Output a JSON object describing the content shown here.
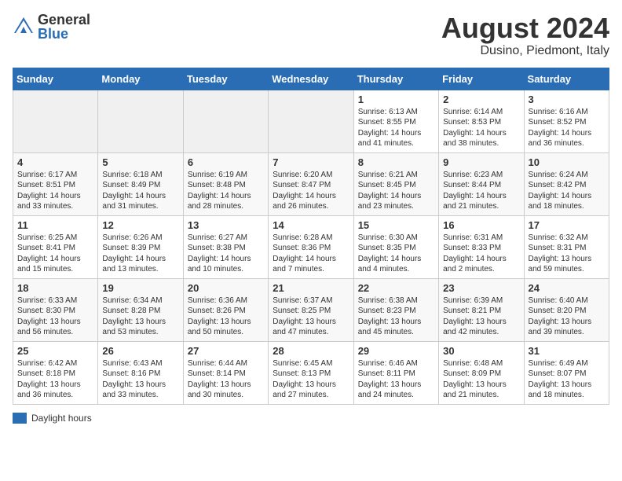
{
  "header": {
    "logo_general": "General",
    "logo_blue": "Blue",
    "month_title": "August 2024",
    "location": "Dusino, Piedmont, Italy"
  },
  "days_of_week": [
    "Sunday",
    "Monday",
    "Tuesday",
    "Wednesday",
    "Thursday",
    "Friday",
    "Saturday"
  ],
  "weeks": [
    [
      {
        "day": "",
        "info": ""
      },
      {
        "day": "",
        "info": ""
      },
      {
        "day": "",
        "info": ""
      },
      {
        "day": "",
        "info": ""
      },
      {
        "day": "1",
        "info": "Sunrise: 6:13 AM\nSunset: 8:55 PM\nDaylight: 14 hours and 41 minutes."
      },
      {
        "day": "2",
        "info": "Sunrise: 6:14 AM\nSunset: 8:53 PM\nDaylight: 14 hours and 38 minutes."
      },
      {
        "day": "3",
        "info": "Sunrise: 6:16 AM\nSunset: 8:52 PM\nDaylight: 14 hours and 36 minutes."
      }
    ],
    [
      {
        "day": "4",
        "info": "Sunrise: 6:17 AM\nSunset: 8:51 PM\nDaylight: 14 hours and 33 minutes."
      },
      {
        "day": "5",
        "info": "Sunrise: 6:18 AM\nSunset: 8:49 PM\nDaylight: 14 hours and 31 minutes."
      },
      {
        "day": "6",
        "info": "Sunrise: 6:19 AM\nSunset: 8:48 PM\nDaylight: 14 hours and 28 minutes."
      },
      {
        "day": "7",
        "info": "Sunrise: 6:20 AM\nSunset: 8:47 PM\nDaylight: 14 hours and 26 minutes."
      },
      {
        "day": "8",
        "info": "Sunrise: 6:21 AM\nSunset: 8:45 PM\nDaylight: 14 hours and 23 minutes."
      },
      {
        "day": "9",
        "info": "Sunrise: 6:23 AM\nSunset: 8:44 PM\nDaylight: 14 hours and 21 minutes."
      },
      {
        "day": "10",
        "info": "Sunrise: 6:24 AM\nSunset: 8:42 PM\nDaylight: 14 hours and 18 minutes."
      }
    ],
    [
      {
        "day": "11",
        "info": "Sunrise: 6:25 AM\nSunset: 8:41 PM\nDaylight: 14 hours and 15 minutes."
      },
      {
        "day": "12",
        "info": "Sunrise: 6:26 AM\nSunset: 8:39 PM\nDaylight: 14 hours and 13 minutes."
      },
      {
        "day": "13",
        "info": "Sunrise: 6:27 AM\nSunset: 8:38 PM\nDaylight: 14 hours and 10 minutes."
      },
      {
        "day": "14",
        "info": "Sunrise: 6:28 AM\nSunset: 8:36 PM\nDaylight: 14 hours and 7 minutes."
      },
      {
        "day": "15",
        "info": "Sunrise: 6:30 AM\nSunset: 8:35 PM\nDaylight: 14 hours and 4 minutes."
      },
      {
        "day": "16",
        "info": "Sunrise: 6:31 AM\nSunset: 8:33 PM\nDaylight: 14 hours and 2 minutes."
      },
      {
        "day": "17",
        "info": "Sunrise: 6:32 AM\nSunset: 8:31 PM\nDaylight: 13 hours and 59 minutes."
      }
    ],
    [
      {
        "day": "18",
        "info": "Sunrise: 6:33 AM\nSunset: 8:30 PM\nDaylight: 13 hours and 56 minutes."
      },
      {
        "day": "19",
        "info": "Sunrise: 6:34 AM\nSunset: 8:28 PM\nDaylight: 13 hours and 53 minutes."
      },
      {
        "day": "20",
        "info": "Sunrise: 6:36 AM\nSunset: 8:26 PM\nDaylight: 13 hours and 50 minutes."
      },
      {
        "day": "21",
        "info": "Sunrise: 6:37 AM\nSunset: 8:25 PM\nDaylight: 13 hours and 47 minutes."
      },
      {
        "day": "22",
        "info": "Sunrise: 6:38 AM\nSunset: 8:23 PM\nDaylight: 13 hours and 45 minutes."
      },
      {
        "day": "23",
        "info": "Sunrise: 6:39 AM\nSunset: 8:21 PM\nDaylight: 13 hours and 42 minutes."
      },
      {
        "day": "24",
        "info": "Sunrise: 6:40 AM\nSunset: 8:20 PM\nDaylight: 13 hours and 39 minutes."
      }
    ],
    [
      {
        "day": "25",
        "info": "Sunrise: 6:42 AM\nSunset: 8:18 PM\nDaylight: 13 hours and 36 minutes."
      },
      {
        "day": "26",
        "info": "Sunrise: 6:43 AM\nSunset: 8:16 PM\nDaylight: 13 hours and 33 minutes."
      },
      {
        "day": "27",
        "info": "Sunrise: 6:44 AM\nSunset: 8:14 PM\nDaylight: 13 hours and 30 minutes."
      },
      {
        "day": "28",
        "info": "Sunrise: 6:45 AM\nSunset: 8:13 PM\nDaylight: 13 hours and 27 minutes."
      },
      {
        "day": "29",
        "info": "Sunrise: 6:46 AM\nSunset: 8:11 PM\nDaylight: 13 hours and 24 minutes."
      },
      {
        "day": "30",
        "info": "Sunrise: 6:48 AM\nSunset: 8:09 PM\nDaylight: 13 hours and 21 minutes."
      },
      {
        "day": "31",
        "info": "Sunrise: 6:49 AM\nSunset: 8:07 PM\nDaylight: 13 hours and 18 minutes."
      }
    ]
  ],
  "legend": {
    "label": "Daylight hours"
  }
}
